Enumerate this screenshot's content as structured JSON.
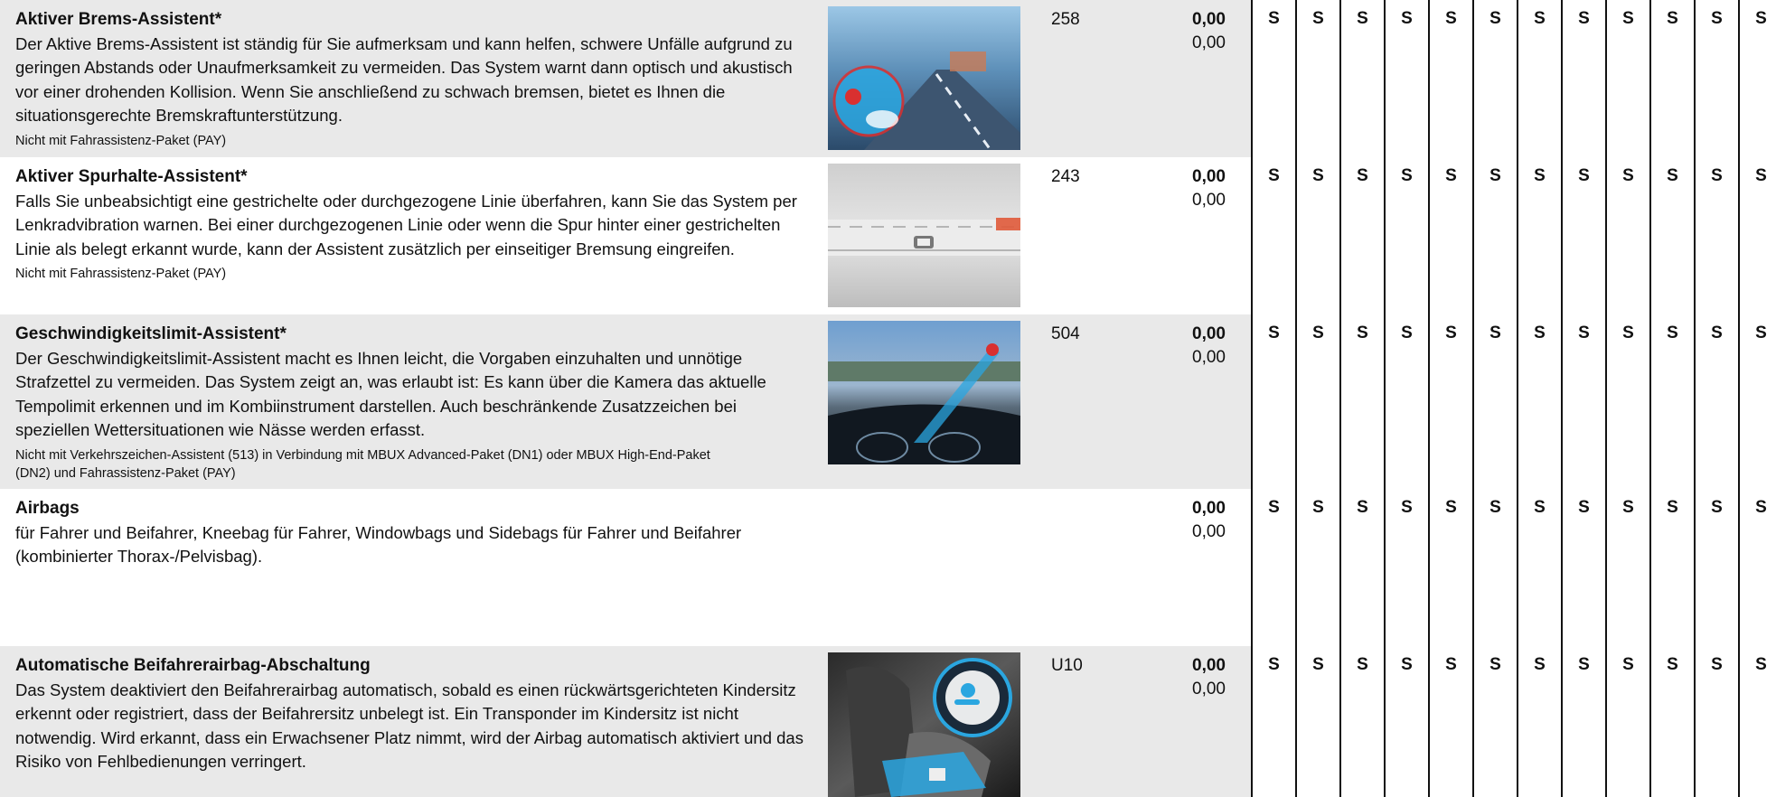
{
  "rows": [
    {
      "title": "Aktiver Brems-Assistent*",
      "description": "Der Aktive Brems-Assistent ist ständig für Sie aufmerksam und kann helfen, schwere Unfälle aufgrund zu geringen Abstands oder Unaufmerksamkeit zu vermeiden. Das System warnt dann optisch und akustisch vor einer drohenden Kollision. Wenn Sie anschließend zu schwach bremsen, bietet es Ihnen die situationsgerechte Bremskraftunterstützung.",
      "note": "Nicht mit Fahrassistenz-Paket (PAY)",
      "code": "258",
      "price_net": "0,00",
      "price_gross": "0,00",
      "image": "brake-assist-image"
    },
    {
      "title": "Aktiver Spurhalte-Assistent*",
      "description": "Falls Sie unbeabsichtigt eine gestrichelte oder durchgezogene Linie überfahren, kann Sie das System per Lenkradvibration warnen. Bei einer durchgezogenen Linie oder wenn die Spur hinter einer gestrichelten Linie als belegt erkannt wurde, kann der Assistent zusätzlich per einseitiger Bremsung eingreifen.",
      "note": "Nicht mit Fahrassistenz-Paket (PAY)",
      "code": "243",
      "price_net": "0,00",
      "price_gross": "0,00",
      "image": "lane-keeping-image"
    },
    {
      "title": "Geschwindigkeitslimit-Assistent*",
      "description": "Der Geschwindigkeitslimit-Assistent macht es Ihnen leicht, die Vorgaben einzuhalten und unnötige Strafzettel zu vermeiden. Das System zeigt an, was erlaubt ist: Es kann über die Kamera das aktuelle Tempolimit erkennen und im Kombiinstrument darstellen. Auch beschränkende Zusatz­zeichen bei speziellen Wettersituationen wie Nässe werden erfasst.",
      "note": "Nicht mit Verkehrszeichen-Assistent (513) in Verbindung mit MBUX Advanced-Paket (DN1) oder MBUX High-End-Paket (DN2) und Fahrassistenz-Paket (PAY)",
      "code": "504",
      "price_net": "0,00",
      "price_gross": "0,00",
      "image": "speed-limit-image"
    },
    {
      "title": "Airbags",
      "description": "für Fahrer und Beifahrer, Kneebag für Fahrer, Windowbags und Sidebags für Fahrer und Beifahrer (kombinierter Thorax-/Pelvisbag).",
      "note": "",
      "code": "",
      "price_net": "0,00",
      "price_gross": "0,00",
      "image": ""
    },
    {
      "title": "Automatische Beifahrerairbag-Abschaltung",
      "description": "Das System deaktiviert den Beifahrerairbag automatisch, sobald es einen rückwärtsgerichteten Kindersitz erkennt oder registriert, dass der Beifahrersitz unbelegt ist. Ein Transponder im Kindersitz ist nicht notwendig. Wird erkannt, dass ein Erwachsener Platz nimmt, wird der Airbag automatisch aktiviert und das Risiko von Fehlbedienungen verringert.",
      "note": "",
      "code": "U10",
      "price_net": "0,00",
      "price_gross": "0,00",
      "image": "airbag-deactivation-image"
    }
  ],
  "availability": [
    "S",
    "S",
    "S",
    "S",
    "S",
    "S",
    "S",
    "S",
    "S",
    "S",
    "S",
    "S"
  ],
  "colors": {
    "row_shade": "#e9e9e9",
    "text": "#111111",
    "accent_blue": "#2aa6e0",
    "accent_red": "#d93030"
  }
}
